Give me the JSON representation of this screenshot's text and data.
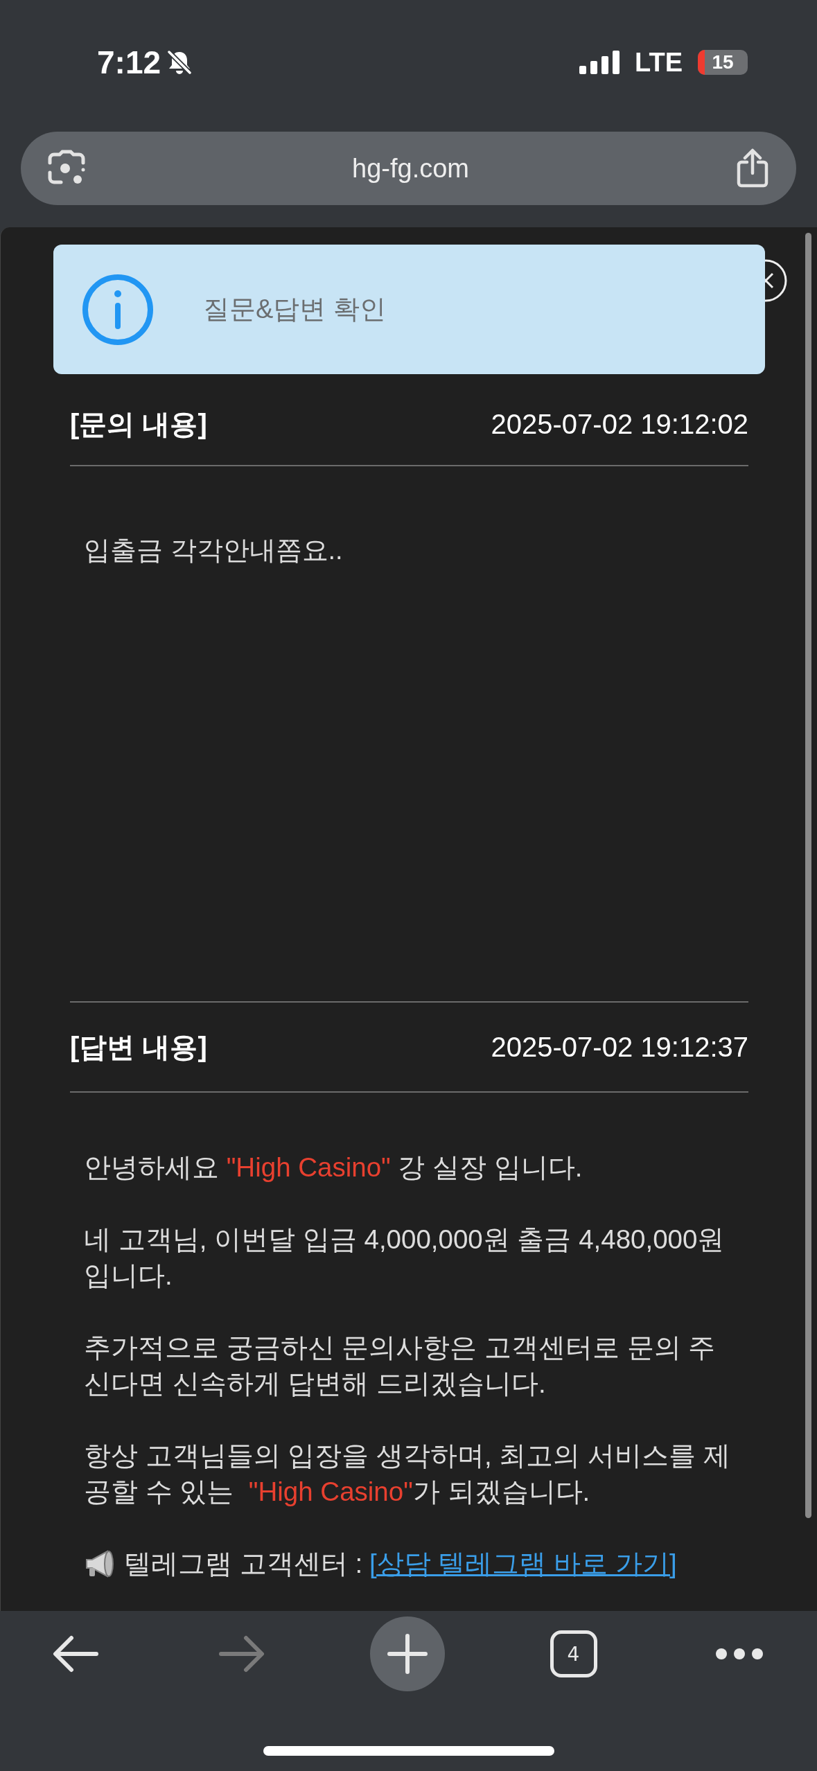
{
  "status_bar": {
    "time": "7:12",
    "network": "LTE",
    "battery": "15"
  },
  "address_bar": {
    "url": "hg-fg.com"
  },
  "toast": {
    "message": "질문&답변 확인"
  },
  "question": {
    "heading": "[문의 내용]",
    "timestamp": "2025-07-02 19:12:02",
    "body": "입출금 각각안내쫌요.."
  },
  "answer": {
    "heading": "[답변 내용]",
    "timestamp": "2025-07-02 19:12:37",
    "paragraphs": [
      [
        {
          "kind": "plain",
          "text": "안녕하세요 "
        },
        {
          "kind": "highlight",
          "text": "\"High Casino\""
        },
        {
          "kind": "plain",
          "text": " 강 실장 입니다."
        }
      ],
      [
        {
          "kind": "plain",
          "text": "네 고객님, 이번달 입금 4,000,000원 출금 4,480,000원 입니다."
        }
      ],
      [
        {
          "kind": "plain",
          "text": "추가적으로 궁금하신 문의사항은 고객센터로 문의 주신다면 신속하게 답변해 드리겠습니다."
        }
      ],
      [
        {
          "kind": "plain",
          "text": "항상 고객님들의 입장을 생각하며, 최고의 서비스를 제공할 수 있는  "
        },
        {
          "kind": "highlight",
          "text": "\"High Casino\""
        },
        {
          "kind": "plain",
          "text": "가 되겠습니다."
        }
      ]
    ],
    "contact": {
      "label": "텔레그램 고객센터 :",
      "link": "[상담 텔레그램 바로 가기]"
    }
  },
  "toolbar": {
    "buttons": [
      {
        "kind": "back",
        "disabled": false
      },
      {
        "kind": "forward",
        "disabled": true
      },
      {
        "kind": "new-tab",
        "disabled": false
      },
      {
        "kind": "tabs",
        "count": "4",
        "disabled": false
      },
      {
        "kind": "more",
        "disabled": false
      }
    ]
  }
}
